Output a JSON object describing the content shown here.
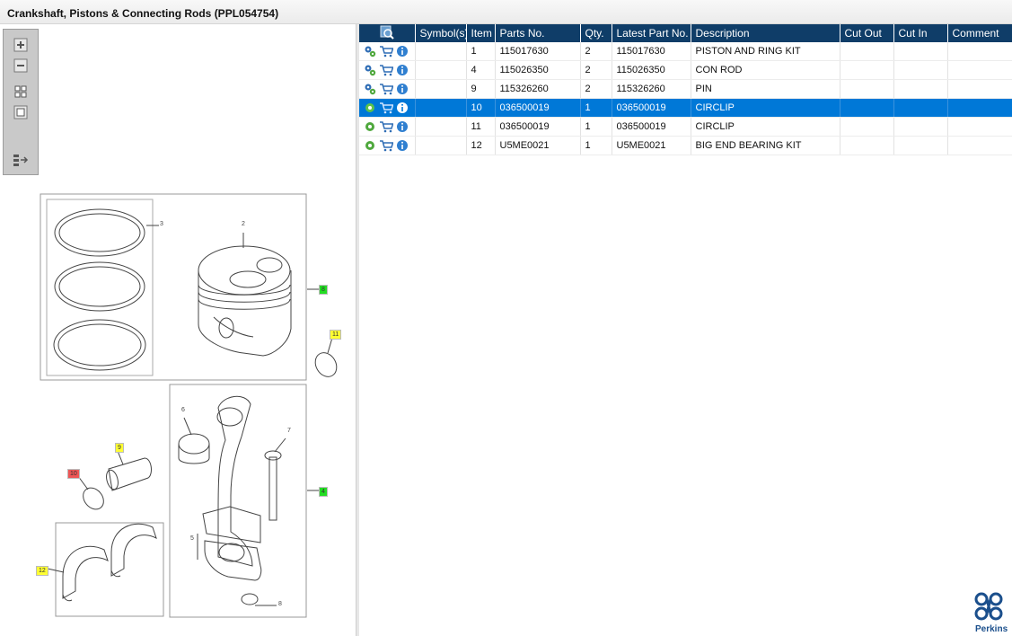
{
  "window": {
    "title": "Crankshaft, Pistons & Connecting Rods (PPL054754)"
  },
  "toolbar": {
    "buttons": [
      "zoom-in",
      "zoom-out",
      "fit-all",
      "fit-page",
      "toggle-split"
    ]
  },
  "diagram": {
    "callouts": [
      {
        "label": "8",
        "color": "#22dd22"
      },
      {
        "label": "11",
        "color": "#ffff33"
      },
      {
        "label": "9",
        "color": "#ffff33"
      },
      {
        "label": "10",
        "color": "#ee5555"
      },
      {
        "label": "4",
        "color": "#22dd22"
      },
      {
        "label": "12",
        "color": "#ffff33"
      }
    ],
    "labels": [
      "3",
      "2",
      "6",
      "7",
      "5",
      "8"
    ]
  },
  "grid": {
    "columns": [
      "",
      "Symbol(s)",
      "Item",
      "Parts No.",
      "Qty.",
      "Latest Part No.",
      "Description",
      "Cut Out",
      "Cut In",
      "Comment"
    ],
    "rows": [
      {
        "item": "1",
        "parts_no": "115017630",
        "qty": "2",
        "latest": "115017630",
        "description": "PISTON AND RING KIT",
        "selected": false
      },
      {
        "item": "4",
        "parts_no": "115026350",
        "qty": "2",
        "latest": "115026350",
        "description": "CON ROD",
        "selected": false
      },
      {
        "item": "9",
        "parts_no": "115326260",
        "qty": "2",
        "latest": "115326260",
        "description": "PIN",
        "selected": false
      },
      {
        "item": "10",
        "parts_no": "036500019",
        "qty": "1",
        "latest": "036500019",
        "description": "CIRCLIP",
        "selected": true
      },
      {
        "item": "11",
        "parts_no": "036500019",
        "qty": "1",
        "latest": "036500019",
        "description": "CIRCLIP",
        "selected": false
      },
      {
        "item": "12",
        "parts_no": "U5ME0021",
        "qty": "1",
        "latest": "U5ME0021",
        "description": "BIG END BEARING KIT",
        "selected": false
      }
    ]
  },
  "logo": {
    "text": "Perkins"
  },
  "colors": {
    "header": "#0f3d68",
    "selection": "#0078d7",
    "brand": "#1b4f8c"
  }
}
